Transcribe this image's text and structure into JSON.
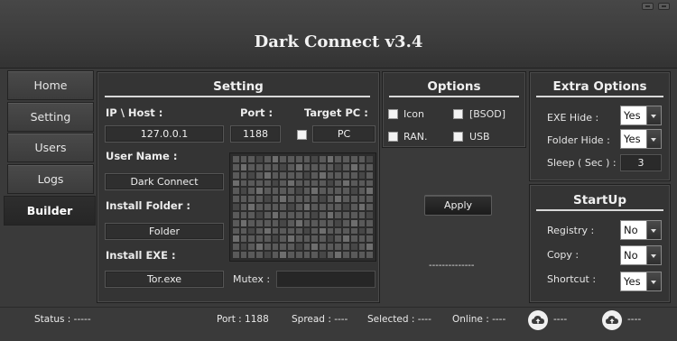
{
  "app": {
    "title": "Dark Connect v3.4"
  },
  "sidebar": {
    "items": [
      {
        "label": "Home"
      },
      {
        "label": "Setting"
      },
      {
        "label": "Users"
      },
      {
        "label": "Logs"
      },
      {
        "label": "Builder",
        "active": true
      }
    ]
  },
  "setting": {
    "title": "Setting",
    "ip_label": "IP \\ Host :",
    "ip_value": "127.0.0.1",
    "port_label": "Port :",
    "port_value": "1188",
    "target_label": "Target PC :",
    "target_value": "PC",
    "username_label": "User Name :",
    "username_value": "Dark Connect",
    "install_folder_label": "Install Folder :",
    "install_folder_value": "Folder",
    "install_exe_label": "Install EXE :",
    "install_exe_value": "Tor.exe",
    "mutex_label": "Mutex :",
    "mutex_value": ""
  },
  "options": {
    "title": "Options",
    "items": [
      {
        "label": "Icon",
        "checked": false
      },
      {
        "label": "[BSOD]",
        "checked": false
      },
      {
        "label": "RAN.",
        "checked": false
      },
      {
        "label": "USB",
        "checked": false
      }
    ],
    "apply_label": "Apply",
    "placeholder_text": "--------------"
  },
  "extra_options": {
    "title": "Extra Options",
    "exe_hide_label": "EXE Hide :",
    "exe_hide_value": "Yes",
    "folder_hide_label": "Folder Hide :",
    "folder_hide_value": "Yes",
    "sleep_label": "Sleep ( Sec ) :",
    "sleep_value": "3"
  },
  "startup": {
    "title": "StartUp",
    "registry_label": "Registry :",
    "registry_value": "No",
    "copy_label": "Copy :",
    "copy_value": "No",
    "shortcut_label": "Shortcut :",
    "shortcut_value": "Yes"
  },
  "status": {
    "status_text": "Status : -----",
    "port_text": "Port : 1188",
    "spread_text": "Spread : ----",
    "selected_text": "Selected : ----",
    "online_text": "Online : ----",
    "upload_text": "----",
    "download_text": "----",
    "upload_icon": "cloud-upload-icon",
    "download_icon": "cloud-download-icon"
  }
}
